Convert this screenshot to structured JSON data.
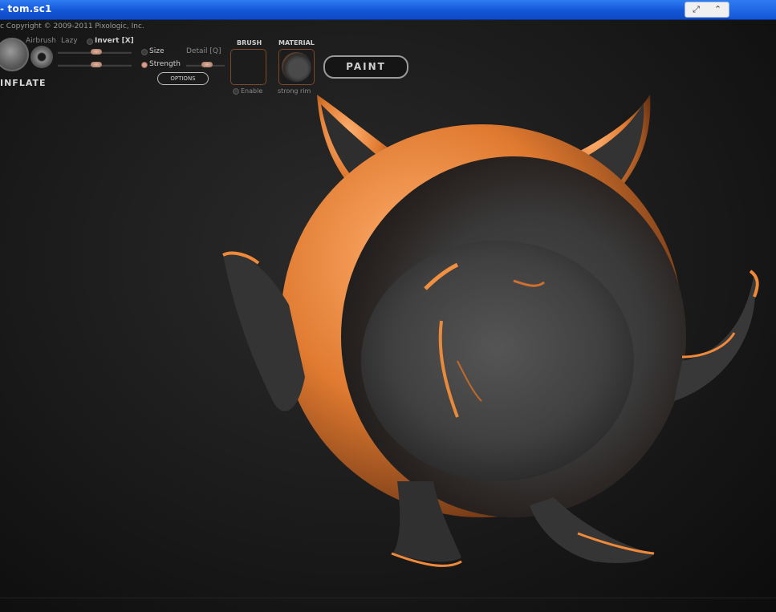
{
  "window": {
    "title": "- tom.sc1",
    "controls": [
      "restore-icon",
      "up-arrow-icon"
    ]
  },
  "header": {
    "copyright": "c   Copyright © 2009-2011 Pixologic, Inc."
  },
  "brush_panel": {
    "brush_name": "INFLATE",
    "airbrush_label": "Airbrush",
    "lazy_label": "Lazy",
    "invert_label": "Invert [X]",
    "size_label": "Size",
    "strength_label": "Strength",
    "detail_label": "Detail [Q]",
    "options_label": "OPTIONS",
    "brush_section_label": "BRUSH",
    "enable_label": "Enable",
    "material_section_label": "MATERIAL",
    "material_name": "strong rim",
    "paint_label": "PAINT"
  },
  "colors": {
    "titlebar": "#1356d8",
    "rim_light": "#f08a3a",
    "model_base": "#3c3c3c",
    "background": "#141414"
  }
}
